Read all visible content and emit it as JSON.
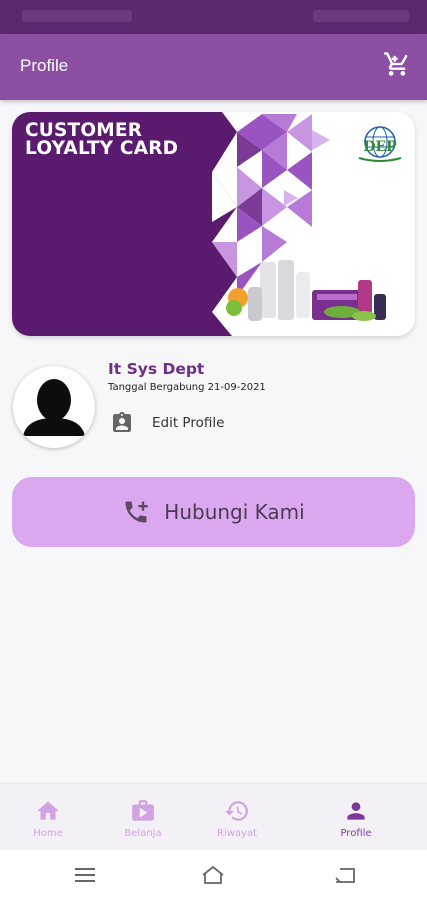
{
  "app_bar": {
    "title": "Profile",
    "cart_icon": "shopping-cart-icon"
  },
  "loyalty_card": {
    "title_line1": "CUSTOMER",
    "title_line2": "LOYALTY CARD",
    "logo_text": "DEP",
    "colors": {
      "primary": "#5a1a6e",
      "accent": "#9a54c2",
      "light": "#c896e0"
    }
  },
  "profile": {
    "name": "It Sys Dept",
    "joined": "Tanggal Bergabung 21-09-2021",
    "edit_label": "Edit Profile"
  },
  "contact_button": {
    "label": "Hubungi Kami",
    "color": "#dba8f0"
  },
  "bottom_nav": {
    "items": [
      {
        "label": "Home",
        "icon": "home-icon",
        "active": false
      },
      {
        "label": "Belanja",
        "icon": "shopping-bag-icon",
        "active": false
      },
      {
        "label": "Riwayat",
        "icon": "history-icon",
        "active": false
      },
      {
        "label": "Profile",
        "icon": "person-icon",
        "active": true
      }
    ]
  },
  "system_nav": {
    "icons": [
      "menu-icon",
      "home-outline-icon",
      "back-icon"
    ]
  },
  "colors": {
    "app_bar": "#8c4fa4",
    "status_bar": "#5b2a6e",
    "active_nav": "#7b3a95",
    "inactive_nav": "#d1a3e3"
  }
}
